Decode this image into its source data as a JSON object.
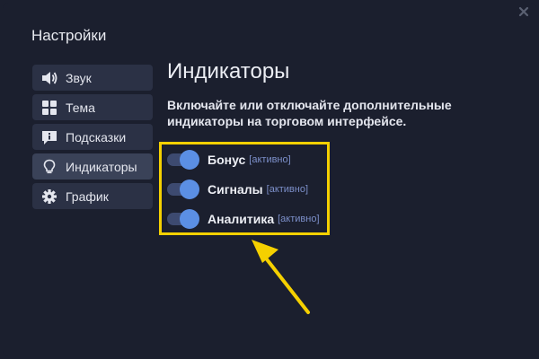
{
  "window": {
    "title": "Настройки",
    "close_icon": "close-icon"
  },
  "sidebar": {
    "items": [
      {
        "label": "Звук",
        "icon": "speaker-icon",
        "active": false
      },
      {
        "label": "Тема",
        "icon": "grid-icon",
        "active": false
      },
      {
        "label": "Подсказки",
        "icon": "info-icon",
        "active": false
      },
      {
        "label": "Индикаторы",
        "icon": "lightbulb-icon",
        "active": true
      },
      {
        "label": "График",
        "icon": "gear-icon",
        "active": false
      }
    ]
  },
  "main": {
    "heading": "Индикаторы",
    "description_line1": "Включайте или отключайте дополнительные",
    "description_line2": "индикаторы на торговом интерфейсе.",
    "toggles": [
      {
        "label": "Бонус",
        "status": "[активно]",
        "on": true
      },
      {
        "label": "Сигналы",
        "status": "[активно]",
        "on": true
      },
      {
        "label": "Аналитика",
        "status": "[активно]",
        "on": true
      }
    ]
  },
  "colors": {
    "background": "#1b1f2e",
    "nav_item": "#2b3145",
    "nav_item_active": "#3a4258",
    "toggle_knob": "#5b8fe4",
    "toggle_track": "#3d4a70",
    "status_text": "#7c8fc9",
    "highlight": "#f5d000"
  }
}
